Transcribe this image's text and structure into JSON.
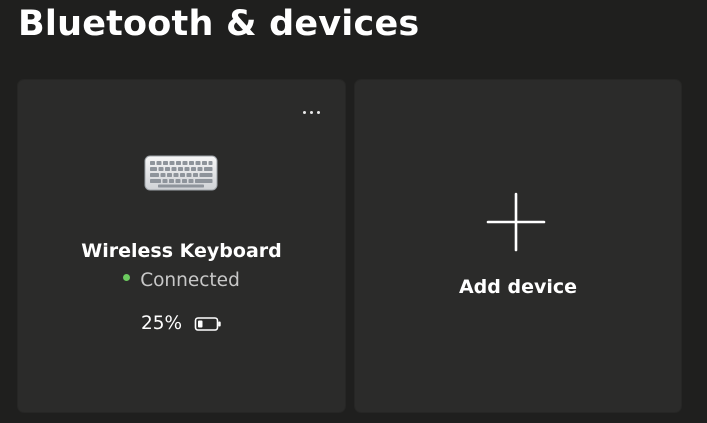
{
  "page": {
    "title": "Bluetooth & devices"
  },
  "device_card": {
    "name": "Wireless Keyboard",
    "status": "Connected",
    "status_color": "#6ccb5f",
    "battery_label": "25%",
    "battery_level": 0.25,
    "icon": "keyboard-icon",
    "more_icon": "more-options-icon"
  },
  "add_card": {
    "label": "Add device",
    "icon": "plus-icon"
  },
  "colors": {
    "background": "#1f1f1e",
    "card": "#2b2b2a",
    "text": "#ffffff",
    "muted_text": "#c8c8c8",
    "connected": "#6ccb5f"
  }
}
